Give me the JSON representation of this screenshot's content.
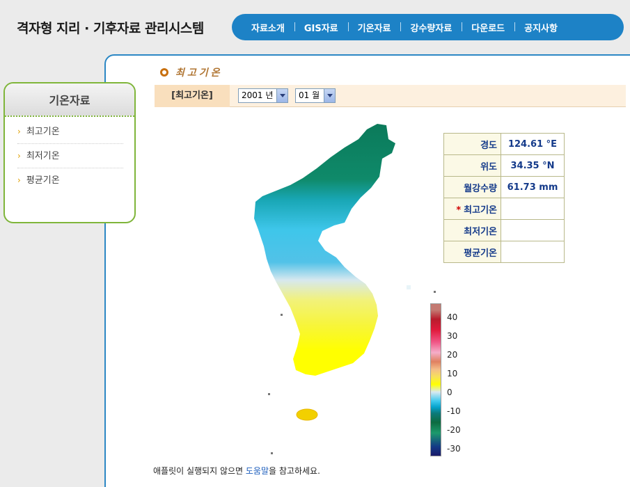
{
  "header": {
    "title": "격자형 지리 · 기후자료 관리시스템",
    "nav": [
      "자료소개",
      "GIS자료",
      "기온자료",
      "강수량자료",
      "다운로드",
      "공지사항"
    ]
  },
  "sidebar": {
    "title": "기온자료",
    "items": [
      "최고기온",
      "최저기온",
      "평균기온"
    ]
  },
  "page": {
    "heading": "최고기온",
    "filter_label": "[최고기온]",
    "year_select": "2001 년",
    "month_select": "01 월"
  },
  "info_table": {
    "rows": [
      {
        "label": "경도",
        "value": "124.61 °E",
        "starred": false
      },
      {
        "label": "위도",
        "value": "34.35 °N",
        "starred": false
      },
      {
        "label": "월강수량",
        "value": "61.73 mm",
        "starred": false
      },
      {
        "label": "최고기온",
        "value": "",
        "starred": true,
        "star": "*"
      },
      {
        "label": "최저기온",
        "value": "",
        "starred": false
      },
      {
        "label": "평균기온",
        "value": "",
        "starred": false
      }
    ]
  },
  "legend": {
    "ticks": [
      "40",
      "30",
      "20",
      "10",
      "0",
      "-10",
      "-20",
      "-30"
    ]
  },
  "footer": {
    "note_before": "애플릿이 실행되지 않으면 ",
    "note_link": "도움말",
    "note_after": "을 참고하세요."
  },
  "colors": {
    "nav_blue": "#1d82c6",
    "sidebar_green": "#7fb53a",
    "label_navy": "#143a8a"
  }
}
